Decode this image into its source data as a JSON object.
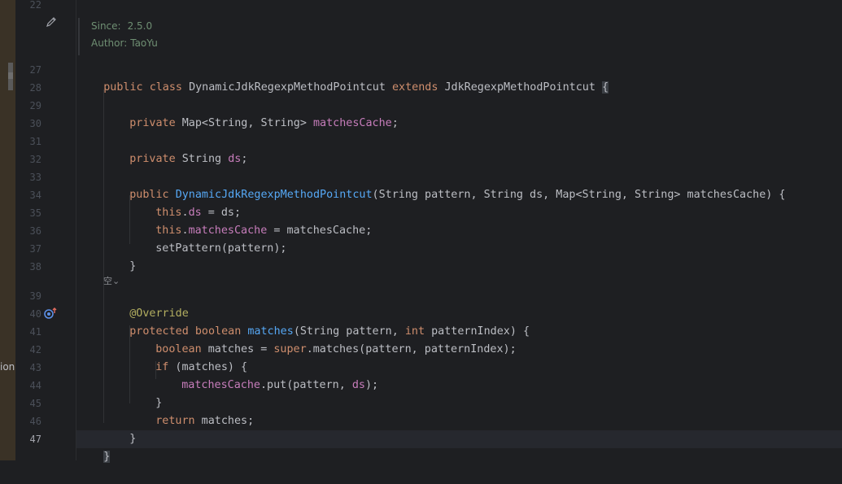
{
  "side_panel": {
    "clipped_text": "ion"
  },
  "doc": {
    "since_label": "Since:",
    "since_value": "2.5.0",
    "author_label": "Author:",
    "author_value": "TaoYu"
  },
  "gutter": {
    "line_numbers": [
      "22",
      "27",
      "28",
      "29",
      "30",
      "31",
      "32",
      "33",
      "34",
      "35",
      "36",
      "37",
      "38",
      "39",
      "40",
      "41",
      "42",
      "43",
      "44",
      "45",
      "46",
      "47"
    ],
    "current_line": "47"
  },
  "inlay_hint": "空⌄",
  "icons": {
    "edit_doc": "pencil-icon",
    "override_marker": "override-up-arrow-icon"
  },
  "code": {
    "l27": {
      "kw1": "public",
      "kw2": "class",
      "name": "DynamicJdkRegexpMethodPointcut",
      "kw3": "extends",
      "parent": "JdkRegexpMethodPointcut",
      "brace": "{"
    },
    "l29": {
      "kw": "private",
      "type": "Map<String, String>",
      "field": "matchesCache",
      "end": ";"
    },
    "l31": {
      "kw": "private",
      "type": "String",
      "field": "ds",
      "end": ";"
    },
    "l33": {
      "kw": "public",
      "fn": "DynamicJdkRegexpMethodPointcut",
      "params": "(String pattern, String ds, Map<String, String> matchesCache) {"
    },
    "l34": {
      "this": "this",
      "dot": ".",
      "field": "ds",
      "rest": " = ds;"
    },
    "l35": {
      "this": "this",
      "dot": ".",
      "field": "matchesCache",
      "rest": " = matchesCache;"
    },
    "l36": {
      "text": "setPattern(pattern);"
    },
    "l37": {
      "text": "}"
    },
    "l39": {
      "ann": "@Override"
    },
    "l40": {
      "kw1": "protected",
      "kw2": "boolean",
      "fn": "matches",
      "p1": "(String pattern, ",
      "kw3": "int",
      "p2": " patternIndex) {"
    },
    "l41": {
      "kw": "boolean",
      "mid": " matches = ",
      "super": "super",
      "rest": ".matches(pattern, patternIndex);"
    },
    "l42": {
      "kw": "if",
      "rest": " (matches) {"
    },
    "l43": {
      "field": "matchesCache",
      "mid": ".put(pattern, ",
      "field2": "ds",
      "end": ");"
    },
    "l44": {
      "text": "}"
    },
    "l45": {
      "kw": "return",
      "rest": " matches;"
    },
    "l46": {
      "text": "}"
    },
    "l47": {
      "text": "}"
    }
  }
}
